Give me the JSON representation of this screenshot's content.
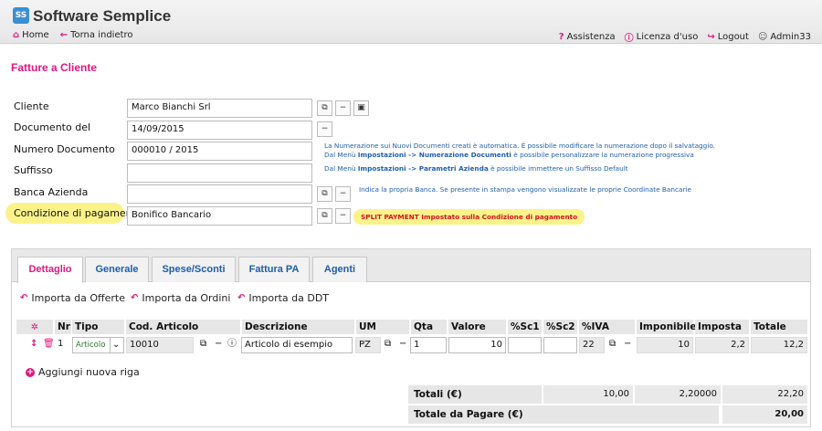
{
  "app": {
    "title": "Software Semplice",
    "logo_text": "SS"
  },
  "nav": {
    "left": [
      {
        "label": "Home",
        "icon": "home-icon"
      },
      {
        "label": "Torna indietro",
        "icon": "back-arrow-icon"
      }
    ],
    "right": [
      {
        "label": "Assistenza",
        "icon": "question-icon"
      },
      {
        "label": "Licenza d'uso",
        "icon": "info-icon"
      },
      {
        "label": "Logout",
        "icon": "logout-icon"
      },
      {
        "label": "Admin33",
        "icon": "user-icon"
      }
    ]
  },
  "page": {
    "title": "Fatture a Cliente"
  },
  "form": {
    "cliente": {
      "label": "Cliente",
      "value": "Marco Bianchi Srl"
    },
    "documento_del": {
      "label": "Documento del",
      "value": "14/09/2015"
    },
    "numero_documento": {
      "label": "Numero Documento",
      "value": "000010 / 2015"
    },
    "suffisso": {
      "label": "Suffisso",
      "value": ""
    },
    "banca_azienda": {
      "label": "Banca Azienda",
      "value": ""
    },
    "condizione_pagamento": {
      "label": "Condizione di pagamento",
      "value": "Bonifico Bancario"
    }
  },
  "hints": {
    "numerazione_1": "La Numerazione sui Nuovi Documenti creati è automatica. È possibile modificare la numerazione dopo il salvataggio.",
    "numerazione_2a": "Dal Menù ",
    "numerazione_2b": "Impostazioni -> Numerazione Documenti",
    "numerazione_2c": " è possibile personalizzare la numerazione progressiva",
    "suffisso_a": "Dal Menù ",
    "suffisso_b": "Impostazioni -> Parametri Azienda",
    "suffisso_c": " è possibile immettere un Suffisso Default",
    "banca": "Indica la propria Banca. Se presente in stampa vengono visualizzate le proprie Coordinate Bancarie",
    "split_payment": "SPLIT PAYMENT Impostato sulla Condizione di pagamento"
  },
  "tabs": [
    {
      "label": "Dettaglio",
      "active": true
    },
    {
      "label": "Generale",
      "active": false
    },
    {
      "label": "Spese/Sconti",
      "active": false
    },
    {
      "label": "Fattura PA",
      "active": false
    },
    {
      "label": "Agenti",
      "active": false
    }
  ],
  "imports": [
    "Importa da Offerte",
    "Importa da Ordini",
    "Importa da DDT"
  ],
  "table": {
    "headers": {
      "nr": "Nr",
      "tipo": "Tipo",
      "cod": "Cod. Articolo",
      "desc": "Descrizione",
      "um": "UM",
      "qta": "Qta",
      "valore": "Valore",
      "sc1": "%Sc1",
      "sc2": "%Sc2",
      "iva": "%IVA",
      "imponibile": "Imponibile",
      "imposta": "Imposta",
      "totale": "Totale"
    },
    "row": {
      "nr": "1",
      "tipo": "Articolo",
      "cod": "10010",
      "desc": "Articolo di esempio",
      "um": "PZ",
      "qta": "1",
      "valore": "10",
      "sc1": "",
      "sc2": "",
      "iva": "22",
      "imponibile": "10",
      "imposta": "2,2",
      "totale": "12,2"
    }
  },
  "add_row": "Aggiungi nuova riga",
  "totals": {
    "totali_label": "Totali (€)",
    "imponibile": "10,00",
    "imposta": "2,20000",
    "totale": "22,20",
    "pagare_label": "Totale da Pagare (€)",
    "pagare": "20,00"
  },
  "colors": {
    "accent": "#e0177d",
    "link": "#1d5da8",
    "highlight": "#fbf38a",
    "warning": "#d8121f"
  }
}
